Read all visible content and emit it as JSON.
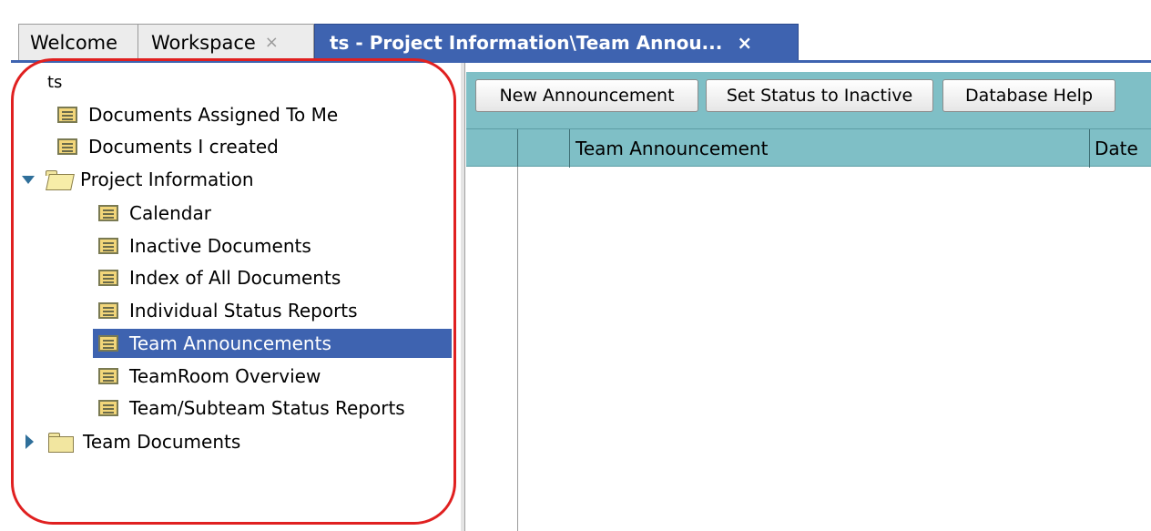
{
  "tabs": [
    {
      "label": "Welcome",
      "closable": false,
      "active": false
    },
    {
      "label": "Workspace",
      "closable": true,
      "active": false
    },
    {
      "label": "ts - Project Information\\Team Annou...",
      "closable": true,
      "active": true
    }
  ],
  "tab_close_glyph": "×",
  "nav": {
    "root_label": "ts",
    "items": [
      {
        "label": "Documents Assigned To Me",
        "type": "view",
        "level": 0
      },
      {
        "label": "Documents I created",
        "type": "view",
        "level": 0
      },
      {
        "label": "Project Information",
        "type": "folder",
        "expanded": true,
        "level": 0
      },
      {
        "label": "Calendar",
        "type": "view",
        "level": 1
      },
      {
        "label": "Inactive Documents",
        "type": "view",
        "level": 1
      },
      {
        "label": "Index of All Documents",
        "type": "view",
        "level": 1
      },
      {
        "label": "Individual Status Reports",
        "type": "view",
        "level": 1
      },
      {
        "label": "Team Announcements",
        "type": "view",
        "level": 1,
        "selected": true
      },
      {
        "label": "TeamRoom Overview",
        "type": "view",
        "level": 1
      },
      {
        "label": "Team/Subteam Status Reports",
        "type": "view",
        "level": 1
      },
      {
        "label": "Team Documents",
        "type": "folder",
        "expanded": false,
        "level": 0
      }
    ]
  },
  "actions": {
    "new_announcement": "New Announcement",
    "set_status_inactive": "Set Status to Inactive",
    "database_help": "Database Help"
  },
  "view_columns": {
    "team_announcement": "Team Announcement",
    "date": "Date"
  },
  "colors": {
    "accent": "#3e63b0",
    "action_bar": "#7fbfc6",
    "highlight_oval": "#e02020"
  }
}
